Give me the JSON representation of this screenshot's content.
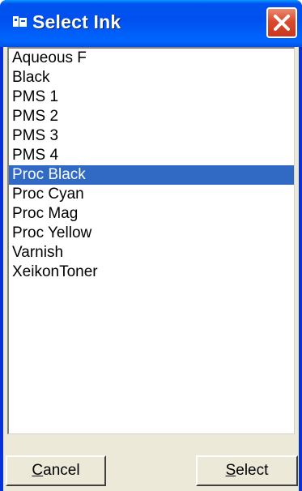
{
  "window": {
    "title": "Select Ink",
    "icon": "ink-app-icon",
    "close_icon": "close-icon"
  },
  "list": {
    "selected_index": 6,
    "items": [
      "Aqueous F",
      "Black",
      "PMS 1",
      "PMS 2",
      "PMS 3",
      "PMS 4",
      "Proc Black",
      "Proc Cyan",
      "Proc Mag",
      "Proc Yellow",
      "Varnish",
      "XeikonToner"
    ]
  },
  "buttons": {
    "cancel": {
      "mnemonic": "C",
      "rest": "ancel"
    },
    "select": {
      "mnemonic": "S",
      "rest": "elect"
    }
  },
  "colors": {
    "titlebar": "#0053ee",
    "selection": "#316ac5",
    "close_button": "#db4a2c",
    "dialog_background": "#ece9d8"
  }
}
